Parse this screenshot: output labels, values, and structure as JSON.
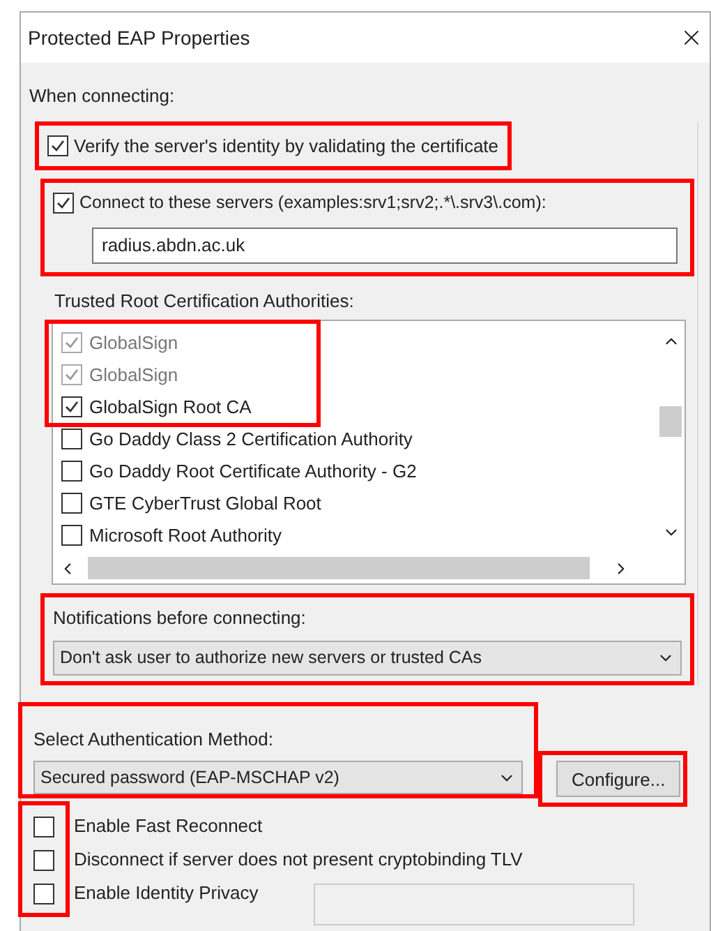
{
  "window": {
    "title": "Protected EAP Properties"
  },
  "when_connecting": {
    "label": "When connecting:",
    "verify": {
      "label": "Verify the server's identity by validating the certificate",
      "checked": true,
      "highlighted": true
    },
    "connect": {
      "label": "Connect to these servers (examples:srv1;srv2;.*\\.srv3\\.com):",
      "checked": true,
      "value": "radius.abdn.ac.uk",
      "highlighted": true
    },
    "trusted_label": "Trusted Root Certification Authorities:",
    "trusted_highlighted": true,
    "authorities": [
      {
        "label": "GlobalSign",
        "checked": true,
        "disabled": true
      },
      {
        "label": "GlobalSign",
        "checked": true,
        "disabled": true
      },
      {
        "label": "GlobalSign Root CA",
        "checked": true,
        "disabled": false
      },
      {
        "label": "Go Daddy Class 2 Certification Authority",
        "checked": false,
        "disabled": false
      },
      {
        "label": "Go Daddy Root Certificate Authority - G2",
        "checked": false,
        "disabled": false
      },
      {
        "label": "GTE CyberTrust Global Root",
        "checked": false,
        "disabled": false
      },
      {
        "label": "Microsoft Root Authority",
        "checked": false,
        "disabled": false
      }
    ],
    "notifications": {
      "label": "Notifications before connecting:",
      "value": "Don't ask user to authorize new servers or trusted CAs",
      "highlighted": true
    }
  },
  "auth_method": {
    "label": "Select Authentication Method:",
    "value": "Secured password (EAP-MSCHAP v2)",
    "highlighted": true
  },
  "configure_button": {
    "label": "Configure...",
    "highlighted": true
  },
  "options_highlighted": true,
  "options": [
    {
      "label": "Enable Fast Reconnect",
      "checked": false
    },
    {
      "label": "Disconnect if server does not present cryptobinding TLV",
      "checked": false
    },
    {
      "label": "Enable Identity Privacy",
      "checked": false
    }
  ]
}
